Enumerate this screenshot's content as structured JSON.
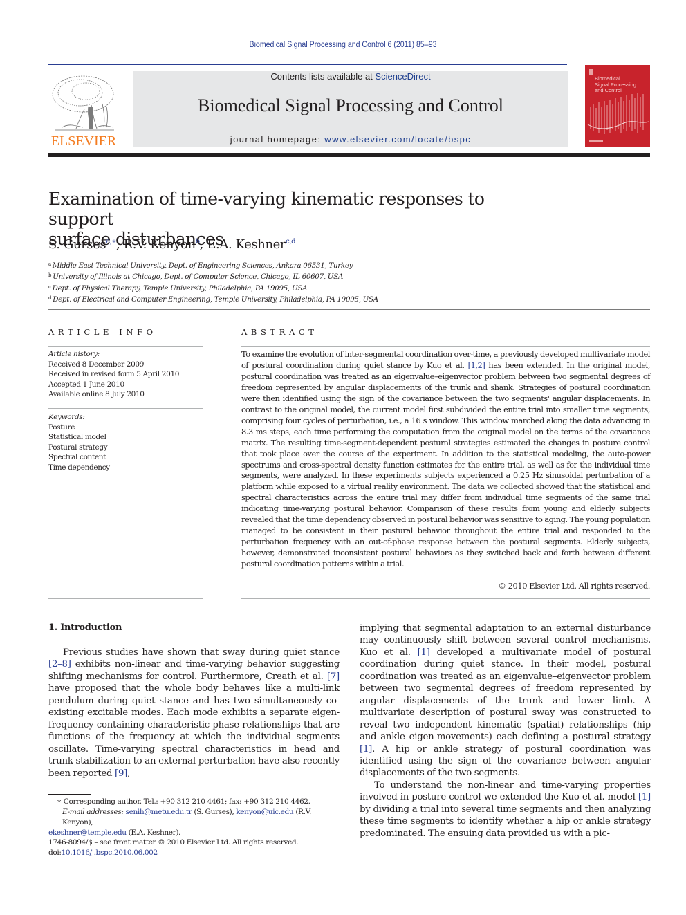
{
  "header": {
    "running_head": "Biomedical Signal Processing and Control 6 (2011) 85–93",
    "contents_prefix": "Contents lists available at ",
    "contents_link": "ScienceDirect",
    "journal_name": "Biomedical Signal Processing and Control",
    "homepage_prefix": "journal homepage: ",
    "homepage_link": "www.elsevier.com/locate/bspc",
    "publisher_logo_text": "ELSEVIER",
    "cover_title": [
      "Biomedical",
      "Signal Processing",
      "and Control"
    ],
    "colors": {
      "link": "#2a3e92",
      "publisher_orange": "#f47c20",
      "cover_red": "#c8232c",
      "banner_grey": "#e6e7e8"
    }
  },
  "article": {
    "title_line1": "Examination of time-varying kinematic responses to support",
    "title_line2": "surface disturbances",
    "authors": [
      {
        "name": "S. Gurses",
        "sup": "a,∗",
        "sep": ", "
      },
      {
        "name": "R.V. Kenyon",
        "sup": "b",
        "sep": ", "
      },
      {
        "name": "E.A. Keshner",
        "sup": "c,d",
        "sep": ""
      }
    ],
    "affiliations": [
      {
        "mark": "a",
        "text": "Middle East Technical University, Dept. of Engineering Sciences, Ankara 06531, Turkey"
      },
      {
        "mark": "b",
        "text": "University of Illinois at Chicago, Dept. of Computer Science, Chicago, IL 60607, USA"
      },
      {
        "mark": "c",
        "text": "Dept. of Physical Therapy, Temple University, Philadelphia, PA 19095, USA"
      },
      {
        "mark": "d",
        "text": "Dept. of Electrical and Computer Engineering, Temple University, Philadelphia, PA 19095, USA"
      }
    ]
  },
  "article_info": {
    "label": "ARTICLE INFO",
    "history_label": "Article history:",
    "history": [
      "Received 8 December 2009",
      "Received in revised form 5 April 2010",
      "Accepted 1 June 2010",
      "Available online 8 July 2010"
    ],
    "keywords_label": "Keywords:",
    "keywords": [
      "Posture",
      "Statistical model",
      "Postural strategy",
      "Spectral content",
      "Time dependency"
    ]
  },
  "abstract": {
    "label": "ABSTRACT",
    "text_before_ref": "To examine the evolution of inter-segmental coordination over-time, a previously developed multivariate model of postural coordination during quiet stance by Kuo et al. ",
    "ref": "[1,2]",
    "text_after_ref": " has been extended. In the original model, postural coordination was treated as an eigenvalue–eigenvector problem between two segmental degrees of freedom represented by angular displacements of the trunk and shank. Strategies of postural coordination were then identified using the sign of the covariance between the two segments' angular displacements. In contrast to the original model, the current model first subdivided the entire trial into smaller time segments, comprising four cycles of perturbation, i.e., a 16 s window. This window marched along the data advancing in 8.3 ms steps, each time performing the computation from the original model on the terms of the covariance matrix. The resulting time-segment-dependent postural strategies estimated the changes in posture control that took place over the course of the experiment. In addition to the statistical modeling, the auto-power spectrums and cross-spectral density function estimates for the entire trial, as well as for the individual time segments, were analyzed. In these experiments subjects experienced a 0.25 Hz sinusoidal perturbation of a platform while exposed to a virtual reality environment. The data we collected showed that the statistical and spectral characteristics across the entire trial may differ from individual time segments of the same trial indicating time-varying postural behavior. Comparison of these results from young and elderly subjects revealed that the time dependency observed in postural behavior was sensitive to aging. The young population managed to be consistent in their postural behavior throughout the entire trial and responded to the perturbation frequency with an out-of-phase response between the postural segments. Elderly subjects, however, demonstrated inconsistent postural behaviors as they switched back and forth between different postural coordination patterns within a trial.",
    "copyright": "© 2010 Elsevier Ltd. All rights reserved."
  },
  "body": {
    "section_heading": "1.  Introduction",
    "left_para": [
      {
        "t": "Previous studies have shown that sway during quiet stance "
      },
      {
        "r": "[2–8]"
      },
      {
        "t": " exhibits non-linear and time-varying behavior suggesting shifting mechanisms for control. Furthermore, Creath et al. "
      },
      {
        "r": "[7]"
      },
      {
        "t": " have proposed that the whole body behaves like a multi-link pendulum during quiet stance and has two simultaneously co-existing excitable modes. Each mode exhibits a separate eigen-frequency containing characteristic phase relationships that are functions of the frequency at which the individual segments oscillate. Time-varying spectral characteristics in head and trunk stabilization to an external perturbation have also recently been reported "
      },
      {
        "r": "[9]"
      },
      {
        "t": ","
      }
    ],
    "right_para1": [
      {
        "t": "implying that segmental adaptation to an external disturbance may continuously shift between several control mechanisms. Kuo et al. "
      },
      {
        "r": "[1]"
      },
      {
        "t": " developed a multivariate model of postural coordination during quiet stance. In their model, postural coordination was treated as an eigenvalue–eigenvector problem between two segmental degrees of freedom represented by angular displacements of the trunk and lower limb. A multivariate description of postural sway was constructed to reveal two independent kinematic (spatial) relationships (hip and ankle eigen-movements) each defining a postural strategy "
      },
      {
        "r": "[1]"
      },
      {
        "t": ". A hip or ankle strategy of postural coordination was identified using the sign of the covariance between angular displacements of the two segments."
      }
    ],
    "right_para2": [
      {
        "t": "To understand the non-linear and time-varying properties involved in posture control we extended the Kuo et al. model "
      },
      {
        "r": "[1]"
      },
      {
        "t": " by dividing a trial into several time segments and then analyzing these time segments to identify whether a hip or ankle strategy predominated. The ensuing data provided us with a pic-"
      }
    ]
  },
  "footnotes": {
    "corresponding": "∗ Corresponding author. Tel.: +90 312 210 4461; fax: +90 312 210 4462.",
    "email_label": "E-mail addresses: ",
    "emails": [
      {
        "addr": "senih@metu.edu.tr",
        "who": " (S. Gurses), "
      },
      {
        "addr": "kenyon@uic.edu",
        "who": " (R.V. Kenyon), "
      },
      {
        "addr": "ekeshner@temple.edu",
        "who": " (E.A. Keshner)."
      }
    ],
    "issn_line": "1746-8094/$ – see front matter © 2010 Elsevier Ltd. All rights reserved.",
    "doi_prefix": "doi:",
    "doi": "10.1016/j.bspc.2010.06.002"
  }
}
